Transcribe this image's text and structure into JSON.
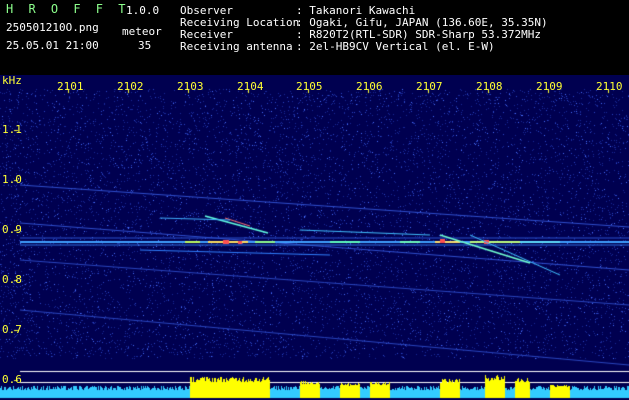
{
  "header": {
    "app_name": "H R O F F T",
    "version": "1.0.0",
    "filename": "250501210O.png",
    "datetime": "25.05.01 21:00",
    "meteor_label": "meteor",
    "meteor_count": "35",
    "info": [
      {
        "key": "Observer",
        "value": ": Takanori Kawachi"
      },
      {
        "key": "Receiving Location",
        "value": ": Ogaki, Gifu, JAPAN (136.60E, 35.35N)"
      },
      {
        "key": "Receiver",
        "value": ": R820T2(RTL-SDR) SDR-Sharp 53.372MHz"
      },
      {
        "key": "Receiving antenna",
        "value": ": 2el-HB9CV Vertical (el. E-W)"
      }
    ]
  },
  "spectrogram": {
    "y_unit": "kHz",
    "x_ticks": [
      "2101",
      "2102",
      "2103",
      "2104",
      "2105",
      "2106",
      "2107",
      "2108",
      "2109",
      "2110"
    ],
    "y_ticks": [
      "1.1",
      "1.0",
      "0.9",
      "0.8",
      "0.7",
      "0.6"
    ],
    "colors": {
      "background": "#000050",
      "tick_text": "#ffff33",
      "scale_line": "#ffffff",
      "level_bar": "#ffff00",
      "noise_floor": "#33ccff"
    }
  }
}
